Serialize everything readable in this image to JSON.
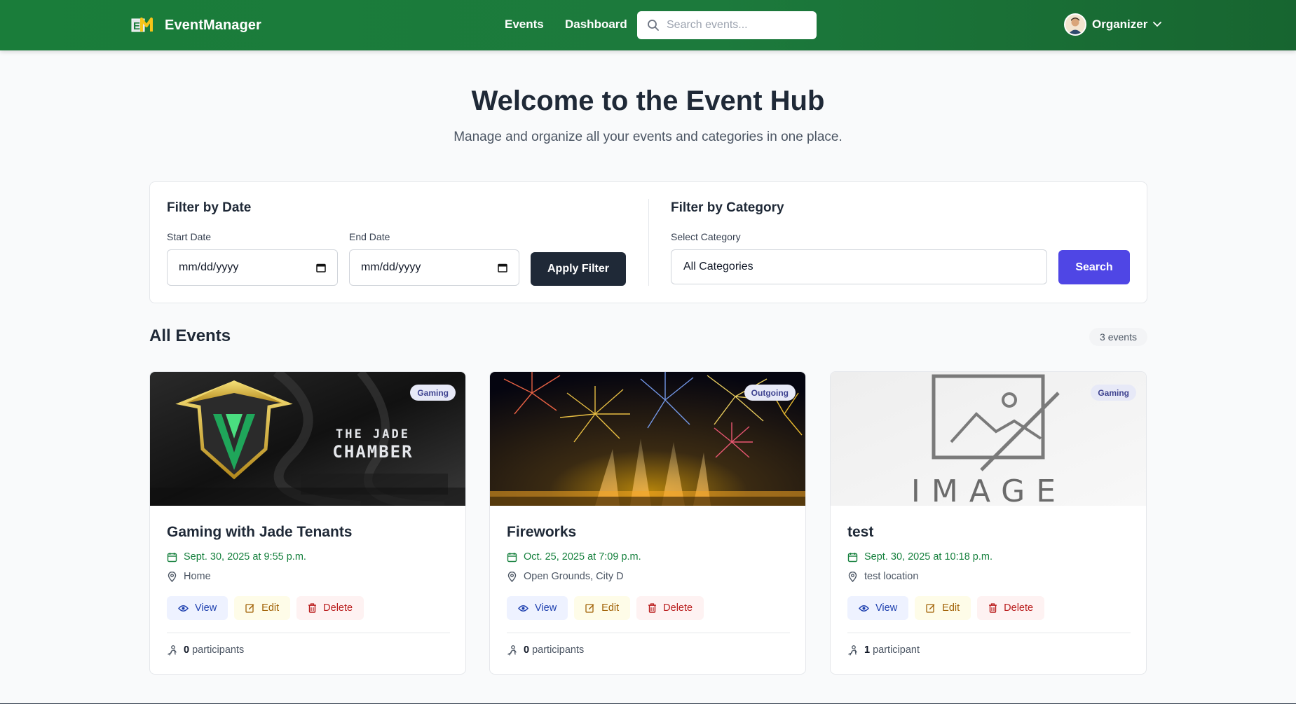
{
  "nav": {
    "brand": "EventManager",
    "links": [
      "Events",
      "Dashboard"
    ],
    "search_placeholder": "Search events...",
    "user": "Organizer"
  },
  "hero": {
    "title": "Welcome to the Event Hub",
    "subtitle": "Manage and organize all your events and categories in one place."
  },
  "filters": {
    "date": {
      "title": "Filter by Date",
      "start_label": "Start Date",
      "end_label": "End Date",
      "start_value": "mm/dd/yyyy",
      "end_value": "mm/dd/yyyy",
      "apply": "Apply Filter"
    },
    "category": {
      "title": "Filter by Category",
      "select_label": "Select Category",
      "selected": "All Categories",
      "search": "Search"
    }
  },
  "events": {
    "heading": "All Events",
    "count": "3 events",
    "items": [
      {
        "title": "Gaming with Jade Tenants",
        "category": "Gaming",
        "date": "Sept. 30, 2025 at 9:55 p.m.",
        "location": "Home",
        "participants_count": "0",
        "participants_label": "participants",
        "image_text": [
          "THE JADE",
          "CHAMBER"
        ]
      },
      {
        "title": "Fireworks",
        "category": "Outgoing",
        "date": "Oct. 25, 2025 at 7:09 p.m.",
        "location": "Open Grounds, City D",
        "participants_count": "0",
        "participants_label": "participants"
      },
      {
        "title": "test",
        "category": "Gaming",
        "date": "Sept. 30, 2025 at 10:18 p.m.",
        "location": "test location",
        "participants_count": "1",
        "participants_label": "participant",
        "image_text": "IMAGE"
      }
    ],
    "actions": {
      "view": "View",
      "edit": "Edit",
      "delete": "Delete"
    }
  },
  "colors": {
    "nav_green": "#1a7d3a",
    "date_green": "#15803d",
    "search_button": "#4f46e5",
    "apply_button": "#1f2937"
  }
}
